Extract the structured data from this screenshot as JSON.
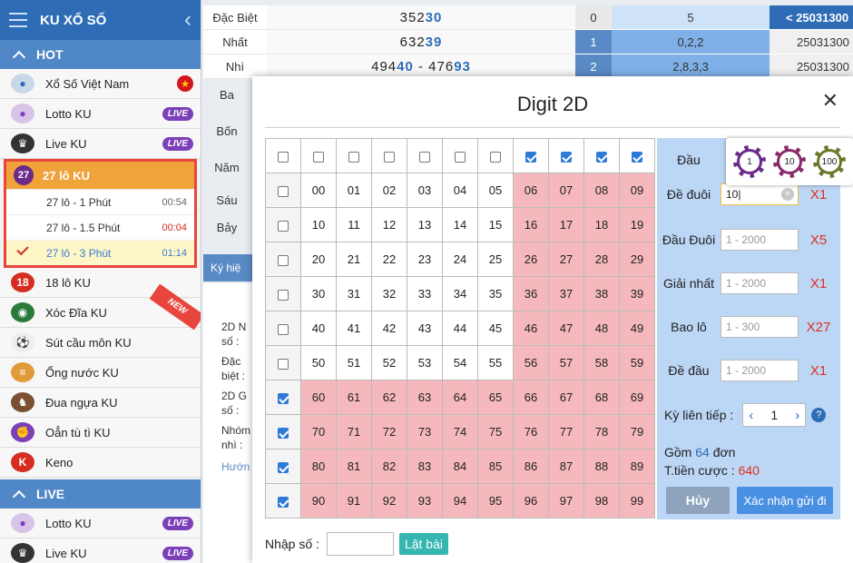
{
  "sidebar": {
    "title": "KU XỔ SỐ",
    "section_hot": "HOT",
    "section_live": "LIVE",
    "items_top": [
      {
        "label": "Xổ Số Việt Nam",
        "badge": ""
      },
      {
        "label": "Lotto KU",
        "badge": "LIVE"
      },
      {
        "label": "Live KU",
        "badge": "LIVE"
      }
    ],
    "group": {
      "label": "27 lô KU",
      "icon_text": "27",
      "subs": [
        {
          "label": "27 lô - 1 Phút",
          "time": "00:54"
        },
        {
          "label": "27 lô - 1.5 Phút",
          "time": "00:04"
        },
        {
          "label": "27 lô - 3 Phút",
          "time": "01:14"
        }
      ]
    },
    "items_bottom": [
      {
        "label": "18 lô KU",
        "icon_text": "18"
      },
      {
        "label": "Xóc Đĩa KU"
      },
      {
        "label": "Sút cầu môn KU"
      },
      {
        "label": "Ống nước KU"
      },
      {
        "label": "Đua ngựa KU"
      },
      {
        "label": "Oẳn tù tì KU"
      },
      {
        "label": "Keno"
      }
    ],
    "live_items": [
      {
        "label": "Lotto KU",
        "badge": "LIVE"
      },
      {
        "label": "Live KU",
        "badge": "LIVE"
      }
    ],
    "new_ribbon": "NEW"
  },
  "results": {
    "rows": [
      {
        "label": "Đặc Biệt",
        "prefix": "352",
        "suffix": "30"
      },
      {
        "label": "Nhất",
        "prefix": "632",
        "suffix": "39"
      },
      {
        "label": "Nhì",
        "prefix": "494",
        "suffix": "40",
        "sep": " - ",
        "prefix2": "476",
        "suffix2": "93"
      }
    ],
    "side_labels": [
      "Ba",
      "Bốn",
      "Năm",
      "Sáu",
      "Bảy"
    ],
    "tab_label": "Ký hiệ",
    "under_text": [
      "2D N",
      "số :",
      "Đặc",
      "biệt :",
      "2D G",
      "số :",
      "Nhóm",
      "nhì :",
      "Hướn"
    ]
  },
  "right_table": {
    "header_date": "< 25031300",
    "rows": [
      {
        "n": "0",
        "c": "5",
        "d": "< 25031300"
      },
      {
        "n": "1",
        "c": "0,2,2",
        "d": "25031300"
      },
      {
        "n": "2",
        "c": "2,8,3,3",
        "d": "25031300"
      }
    ]
  },
  "modal": {
    "title": "Digit 2D",
    "close": "✕",
    "grid_rows": [
      [
        "00",
        "01",
        "02",
        "03",
        "04",
        "05",
        "06",
        "07",
        "08",
        "09"
      ],
      [
        "10",
        "11",
        "12",
        "13",
        "14",
        "15",
        "16",
        "17",
        "18",
        "19"
      ],
      [
        "20",
        "21",
        "22",
        "23",
        "24",
        "25",
        "26",
        "27",
        "28",
        "29"
      ],
      [
        "30",
        "31",
        "32",
        "33",
        "34",
        "35",
        "36",
        "37",
        "38",
        "39"
      ],
      [
        "40",
        "41",
        "42",
        "43",
        "44",
        "45",
        "46",
        "47",
        "48",
        "49"
      ],
      [
        "50",
        "51",
        "52",
        "53",
        "54",
        "55",
        "56",
        "57",
        "58",
        "59"
      ],
      [
        "60",
        "61",
        "62",
        "63",
        "64",
        "65",
        "66",
        "67",
        "68",
        "69"
      ],
      [
        "70",
        "71",
        "72",
        "73",
        "74",
        "75",
        "76",
        "77",
        "78",
        "79"
      ],
      [
        "80",
        "81",
        "82",
        "83",
        "84",
        "85",
        "86",
        "87",
        "88",
        "89"
      ],
      [
        "90",
        "91",
        "92",
        "93",
        "94",
        "95",
        "96",
        "97",
        "98",
        "99"
      ]
    ],
    "panel": {
      "dau_label": "Đầu",
      "rows": [
        {
          "label": "Đề đuôi",
          "value": "10",
          "placeholder": "",
          "mult": "X1"
        },
        {
          "label": "Đầu Đuôi",
          "value": "",
          "placeholder": "1 - 2000",
          "mult": "X5"
        },
        {
          "label": "Giải nhất",
          "value": "",
          "placeholder": "1 - 2000",
          "mult": "X1"
        },
        {
          "label": "Bao lô",
          "value": "",
          "placeholder": "1 - 300",
          "mult": "X27"
        },
        {
          "label": "Đề đầu",
          "value": "",
          "placeholder": "1 - 2000",
          "mult": "X1"
        }
      ],
      "chips": [
        "1",
        "10",
        "100"
      ],
      "ky_label": "Kỳ liên tiếp :",
      "ky_value": "1",
      "sum_prefix": "Gồm ",
      "sum_count": "64",
      "sum_suffix": " đơn",
      "total_label": "T.tiền cược : ",
      "total_value": "640",
      "btn_cancel": "Hủy",
      "btn_confirm": "Xác nhận gửi đi"
    },
    "nhap_label": "Nhập số :",
    "nhap_button": "Lật bài"
  }
}
